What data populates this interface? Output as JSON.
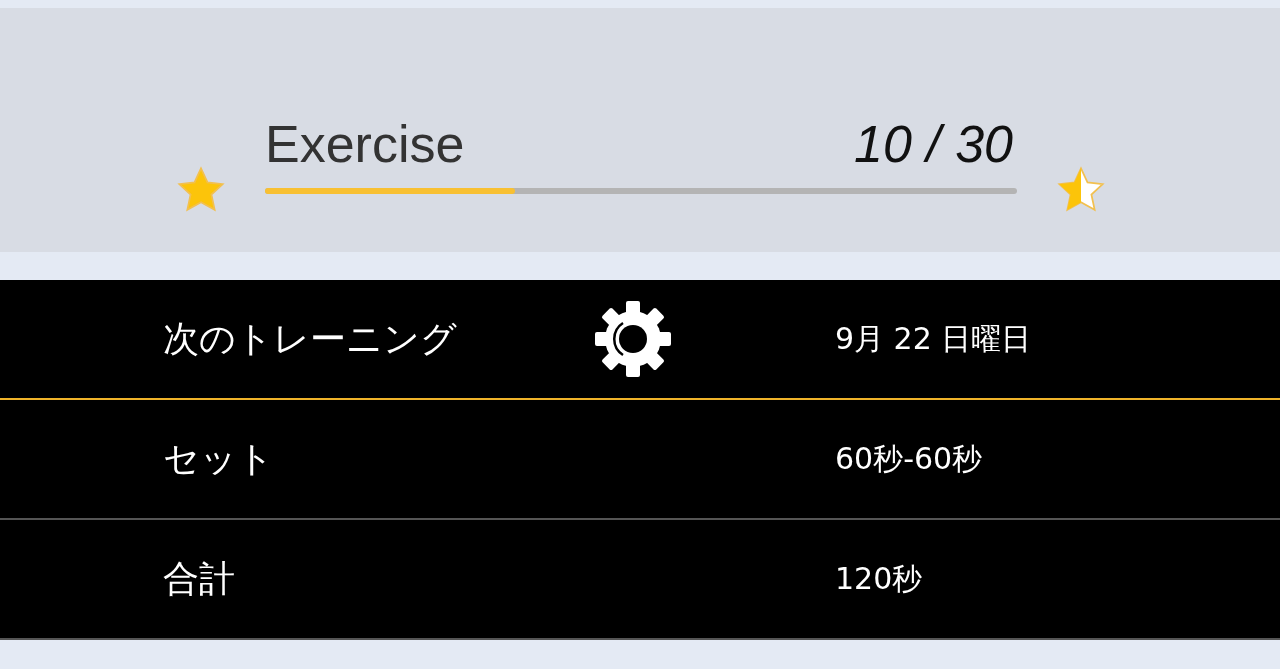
{
  "progress": {
    "title": "Exercise",
    "count": "10 / 30",
    "level": 0.333
  },
  "rows": [
    {
      "label": "次のトレーニング",
      "value": "9月 22 日曜日",
      "settings_button": true,
      "accent": true
    },
    {
      "label": "セット",
      "value": "60秒-60秒",
      "settings_button": false,
      "accent": false
    },
    {
      "label": "合計",
      "value": "120秒",
      "settings_button": false,
      "accent": false
    }
  ]
}
